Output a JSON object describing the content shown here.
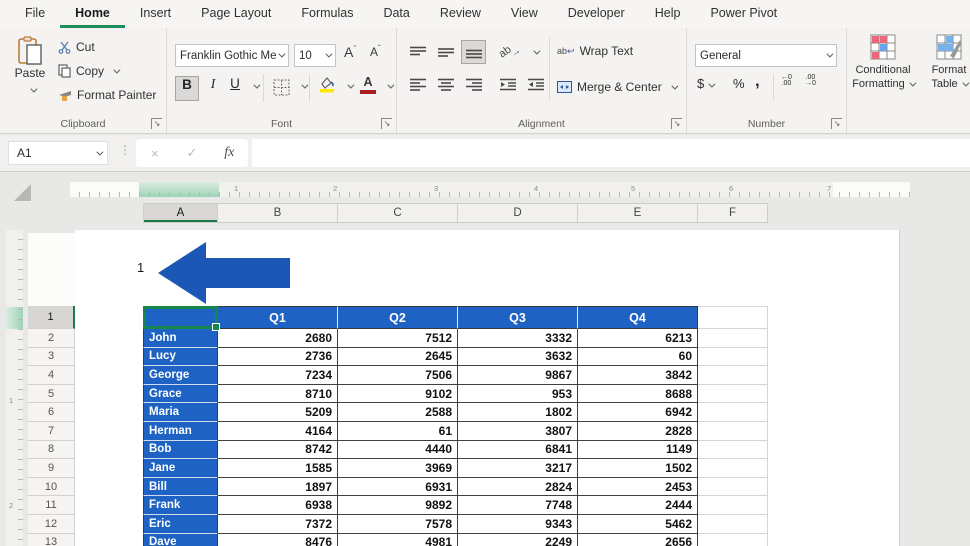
{
  "ribbon": {
    "tabs": [
      "File",
      "Home",
      "Insert",
      "Page Layout",
      "Formulas",
      "Data",
      "Review",
      "View",
      "Developer",
      "Help",
      "Power Pivot"
    ],
    "active_tab": "Home",
    "clipboard": {
      "label": "Clipboard",
      "paste": "Paste",
      "cut": "Cut",
      "copy": "Copy",
      "format_painter": "Format Painter"
    },
    "font": {
      "label": "Font",
      "font_name": "Franklin Gothic Me",
      "font_size": "10",
      "bold": "B",
      "italic": "I",
      "underline": "U"
    },
    "alignment": {
      "label": "Alignment",
      "wrap_text": "Wrap Text",
      "merge_center": "Merge & Center",
      "orientation": "ab"
    },
    "number": {
      "label": "Number",
      "format": "General",
      "currency": "$",
      "percent": "%",
      "comma": ","
    },
    "styles": {
      "conditional_line1": "Conditional",
      "conditional_line2": "Formatting",
      "format_table_line1": "Format",
      "format_table_line2": "Table"
    }
  },
  "formula_bar": {
    "name_box": "A1",
    "fx_label": "fx"
  },
  "sheet": {
    "columns": [
      "A",
      "B",
      "C",
      "D",
      "E",
      "F"
    ],
    "selected_column": "A",
    "row_numbers": [
      "1",
      "2",
      "3",
      "4",
      "5",
      "6",
      "7",
      "8",
      "9",
      "10",
      "11",
      "12",
      "13"
    ],
    "selected_row": "1",
    "h_ruler_numbers": [
      "1",
      "2",
      "3",
      "4",
      "5",
      "6",
      "7"
    ],
    "v_ruler_numbers": [
      "1",
      "2"
    ],
    "annotation_text": "1"
  },
  "sheet_table": {
    "headers": [
      "",
      "Q1",
      "Q2",
      "Q3",
      "Q4"
    ],
    "rows": [
      {
        "name": "John",
        "values": [
          2680,
          7512,
          3332,
          6213
        ]
      },
      {
        "name": "Lucy",
        "values": [
          2736,
          2645,
          3632,
          60
        ]
      },
      {
        "name": "George",
        "values": [
          7234,
          7506,
          9867,
          3842
        ]
      },
      {
        "name": "Grace",
        "values": [
          8710,
          9102,
          953,
          8688
        ]
      },
      {
        "name": "Maria",
        "values": [
          5209,
          2588,
          1802,
          6942
        ]
      },
      {
        "name": "Herman",
        "values": [
          4164,
          61,
          3807,
          2828
        ]
      },
      {
        "name": "Bob",
        "values": [
          8742,
          4440,
          6841,
          1149
        ]
      },
      {
        "name": "Jane",
        "values": [
          1585,
          3969,
          3217,
          1502
        ]
      },
      {
        "name": "Bill",
        "values": [
          1897,
          6931,
          2824,
          2453
        ]
      },
      {
        "name": "Frank",
        "values": [
          6938,
          9892,
          7748,
          2444
        ]
      },
      {
        "name": "Eric",
        "values": [
          7372,
          7578,
          9343,
          5462
        ]
      },
      {
        "name": "Dave",
        "values": [
          8476,
          4981,
          2249,
          2656
        ]
      }
    ]
  },
  "colors": {
    "excel_green": "#1e8e5a",
    "selection_green": "#17864c",
    "table_blue": "#1e63c3",
    "arrow_blue": "#1b57b5",
    "highlight_yellow": "#ffe800",
    "font_red": "#a6201e"
  }
}
